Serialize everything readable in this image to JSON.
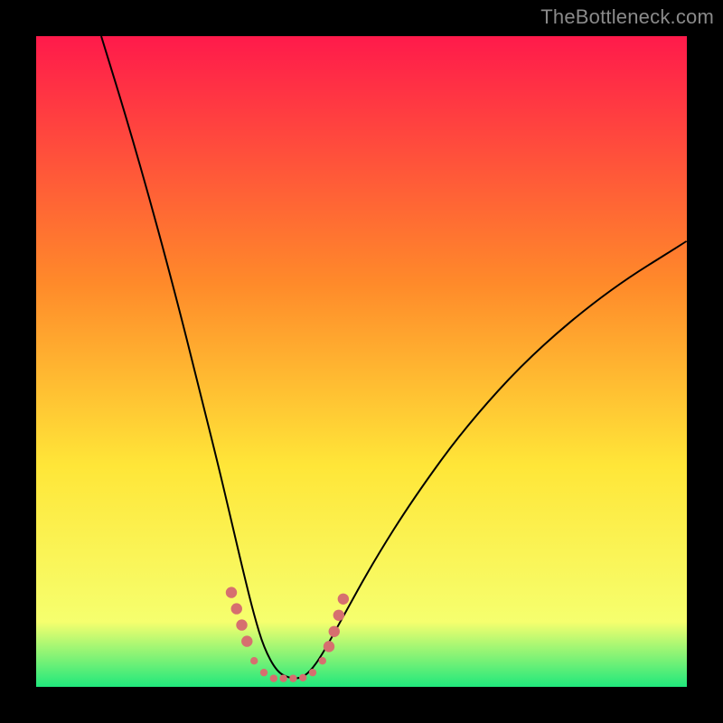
{
  "watermark": "TheBottleneck.com",
  "background": {
    "border_color": "#000000",
    "plot_gradient_top": "#ff1a4b",
    "plot_gradient_mid1": "#ff8a2a",
    "plot_gradient_mid2": "#ffe638",
    "plot_gradient_mid3": "#f6ff6e",
    "plot_gradient_bottom": "#20e87c"
  },
  "chart_data": {
    "type": "line",
    "title": "",
    "xlabel": "",
    "ylabel": "",
    "xlim": [
      0,
      100
    ],
    "ylim": [
      0,
      100
    ],
    "grid": false,
    "legend": false,
    "series": [
      {
        "name": "bottleneck-curve",
        "stroke": "#000000",
        "stroke_width": 2,
        "x": [
          10,
          14,
          18,
          22,
          25,
          28,
          30,
          32,
          33.5,
          35,
          37,
          39,
          40.5,
          42,
          44,
          47,
          52,
          58,
          66,
          76,
          88,
          100
        ],
        "y": [
          100,
          87,
          73,
          58,
          46,
          34,
          25.5,
          17,
          11,
          6,
          2.3,
          1.3,
          1.3,
          2.2,
          5,
          10.5,
          19.5,
          29,
          40,
          51,
          61,
          68.5
        ]
      }
    ],
    "markers": {
      "name": "trough-dots",
      "fill": "#d66f6f",
      "radius_small": 4.2,
      "radius_large": 6.2,
      "points": [
        {
          "x": 30.0,
          "y": 14.5,
          "size": "large"
        },
        {
          "x": 30.8,
          "y": 12.0,
          "size": "large"
        },
        {
          "x": 31.6,
          "y": 9.5,
          "size": "large"
        },
        {
          "x": 32.4,
          "y": 7.0,
          "size": "large"
        },
        {
          "x": 33.5,
          "y": 4.0,
          "size": "small"
        },
        {
          "x": 35.0,
          "y": 2.2,
          "size": "small"
        },
        {
          "x": 36.5,
          "y": 1.3,
          "size": "small"
        },
        {
          "x": 38.0,
          "y": 1.3,
          "size": "small"
        },
        {
          "x": 39.5,
          "y": 1.3,
          "size": "small"
        },
        {
          "x": 41.0,
          "y": 1.4,
          "size": "small"
        },
        {
          "x": 42.5,
          "y": 2.2,
          "size": "small"
        },
        {
          "x": 44.0,
          "y": 4.0,
          "size": "small"
        },
        {
          "x": 45.0,
          "y": 6.2,
          "size": "large"
        },
        {
          "x": 45.8,
          "y": 8.5,
          "size": "large"
        },
        {
          "x": 46.5,
          "y": 11.0,
          "size": "large"
        },
        {
          "x": 47.2,
          "y": 13.5,
          "size": "large"
        }
      ]
    }
  }
}
